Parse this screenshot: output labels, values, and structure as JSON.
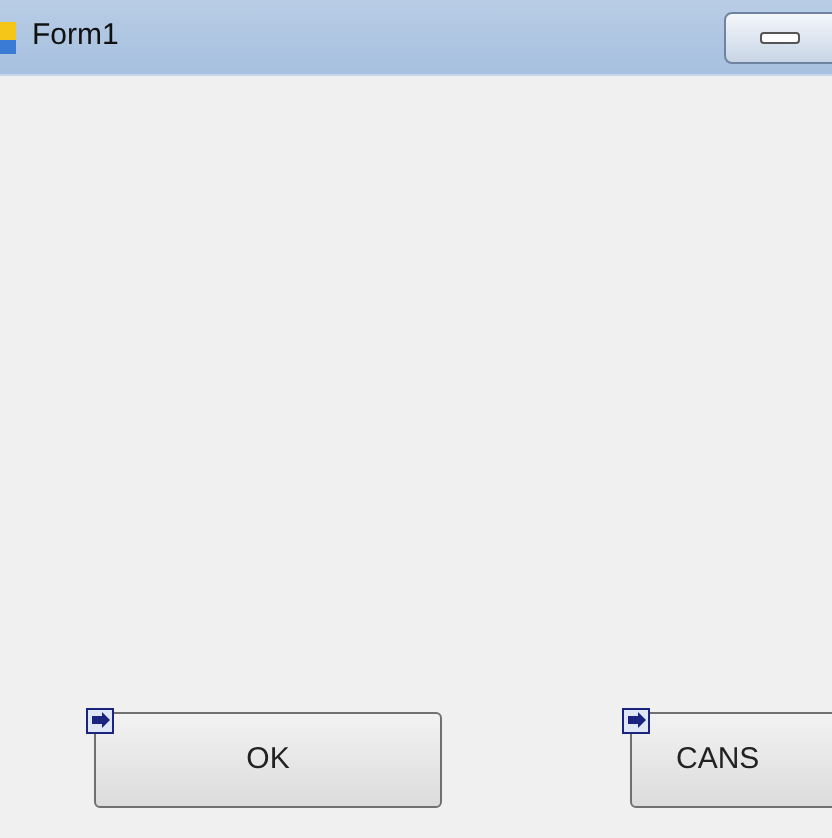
{
  "window": {
    "title": "Form1"
  },
  "buttons": [
    {
      "label": "OK"
    },
    {
      "label": "CANS"
    }
  ]
}
